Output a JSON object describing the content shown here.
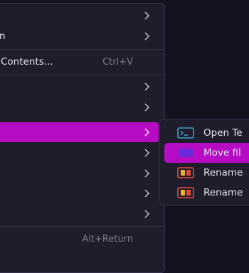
{
  "menu": {
    "items": [
      {
        "label": "",
        "has_submenu": true
      },
      {
        "label": "n",
        "has_submenu": true
      },
      {
        "label": "Contents...",
        "shortcut": "Ctrl+V",
        "has_submenu": false
      },
      {
        "label": "",
        "has_submenu": true
      },
      {
        "label": "",
        "has_submenu": true
      },
      {
        "label": "",
        "has_submenu": true,
        "active": true
      },
      {
        "label": "",
        "has_submenu": true
      },
      {
        "label": "",
        "has_submenu": true
      },
      {
        "label": "",
        "has_submenu": true
      },
      {
        "label": "",
        "has_submenu": true
      },
      {
        "label": "",
        "shortcut": "Alt+Return",
        "has_submenu": false
      }
    ]
  },
  "submenu": {
    "items": [
      {
        "label": "Open Te",
        "icon": "terminal-icon"
      },
      {
        "label": "Move fil",
        "icon": "move-file-icon",
        "active": true
      },
      {
        "label": "Rename",
        "icon": "rename-icon"
      },
      {
        "label": "Rename",
        "icon": "rename-icon"
      }
    ]
  },
  "colors": {
    "menu_bg": "#1f1d2b",
    "highlight": "#b60cc4",
    "text": "#e4e2ee",
    "shortcut_text": "#7c7a8c",
    "terminal_icon": "#3fa0c9",
    "move_icon": "#6a2ad9",
    "rename_icon_red": "#e24b3c",
    "rename_icon_yellow": "#e5b628"
  }
}
